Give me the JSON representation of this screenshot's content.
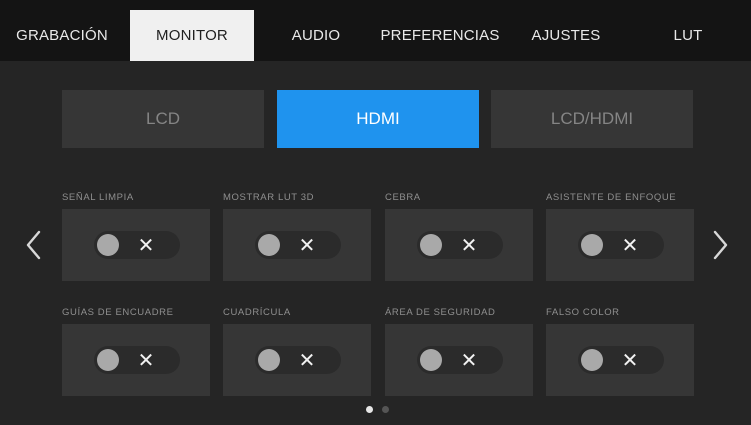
{
  "tabs": [
    {
      "label": "GRABACIÓN",
      "active": false
    },
    {
      "label": "MONITOR",
      "active": true
    },
    {
      "label": "AUDIO",
      "active": false
    },
    {
      "label": "PREFERENCIAS",
      "active": false
    },
    {
      "label": "AJUSTES",
      "active": false
    },
    {
      "label": "LUT",
      "active": false
    }
  ],
  "outputs": [
    {
      "label": "LCD",
      "selected": false
    },
    {
      "label": "HDMI",
      "selected": true
    },
    {
      "label": "LCD/HDMI",
      "selected": false
    }
  ],
  "settings": [
    {
      "label": "SEÑAL LIMPIA",
      "value": "✕",
      "enabled": false
    },
    {
      "label": "MOSTRAR LUT 3D",
      "value": "✕",
      "enabled": false
    },
    {
      "label": "CEBRA",
      "value": "✕",
      "enabled": false
    },
    {
      "label": "ASISTENTE DE ENFOQUE",
      "value": "✕",
      "enabled": false
    },
    {
      "label": "GUÍAS DE ENCUADRE",
      "value": "✕",
      "enabled": false
    },
    {
      "label": "CUADRÍCULA",
      "value": "✕",
      "enabled": false
    },
    {
      "label": "ÁREA DE SEGURIDAD",
      "value": "✕",
      "enabled": false
    },
    {
      "label": "FALSO COLOR",
      "value": "✕",
      "enabled": false
    }
  ],
  "pagination": {
    "current": 1,
    "total": 2
  },
  "colors": {
    "accent": "#1f93ee",
    "tab_active_bg": "#f0f0f0",
    "panel_bg": "#252525",
    "card_bg": "#363636",
    "toggle_off_knob": "#a9a9a9"
  },
  "icons": {
    "prev": "chevron-left-icon",
    "next": "chevron-right-icon",
    "off": "x-icon"
  }
}
